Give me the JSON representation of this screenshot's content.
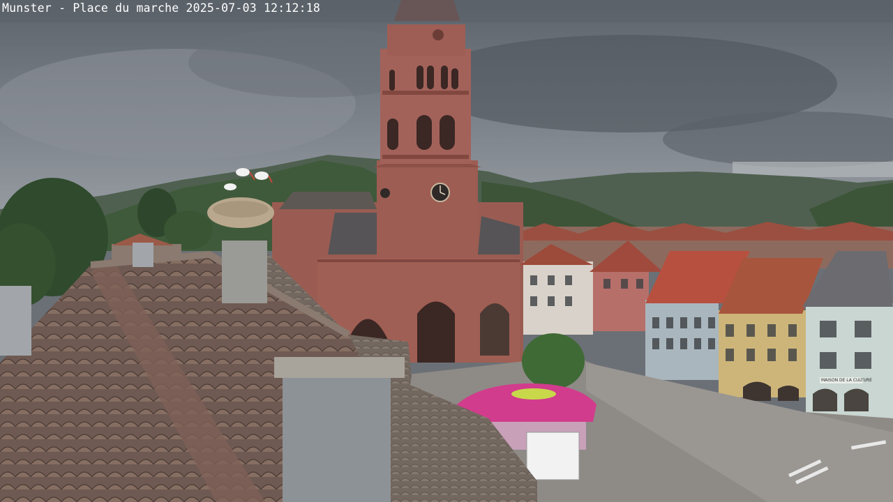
{
  "camera_overlay": {
    "location": "Munster - Place du marche",
    "timestamp": "2025-07-03 12:12:18"
  },
  "scene": {
    "subjects": [
      "church-tower",
      "stork-nest",
      "tiled-roof",
      "chimney",
      "pink-carousel",
      "town-houses",
      "mountains",
      "storm-clouds"
    ],
    "colors": {
      "sky": "#6f757d",
      "sandstone": "#9a5c52",
      "roof_tile": "#6b5a52",
      "carousel": "#d23c8c",
      "hills": "#3f5a3a"
    },
    "signs": {
      "shop_sign": "MAISON DE LA CULTURE"
    }
  }
}
